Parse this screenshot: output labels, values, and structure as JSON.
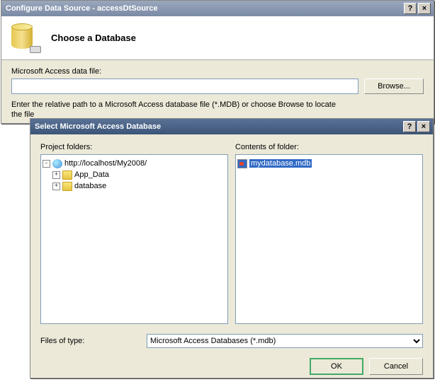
{
  "parent": {
    "title": "Configure Data Source - accessDtSource",
    "heading": "Choose a Database",
    "fileLabel": "Microsoft Access data file:",
    "fileValue": "",
    "browse": "Browse...",
    "hint1": "Enter the relative path to a Microsoft Access database file (*.MDB) or choose Browse to locate",
    "hint2": "the file"
  },
  "dialog": {
    "title": "Select Microsoft Access Database",
    "foldersLabel": "Project folders:",
    "contentsLabel": "Contents of folder:",
    "tree": {
      "root": "http://localhost/My2008/",
      "children": [
        "App_Data",
        "database"
      ]
    },
    "selectedFile": "mydatabase.mdb",
    "filesOfTypeLabel": "Files of type:",
    "filesOfTypeValue": "Microsoft Access Databases (*.mdb)",
    "ok": "OK",
    "cancel": "Cancel"
  }
}
